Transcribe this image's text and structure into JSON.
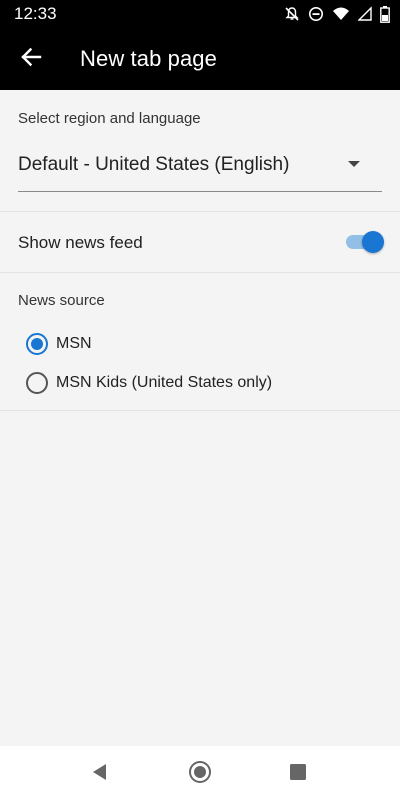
{
  "statusbar": {
    "time": "12:33",
    "icons": [
      "notifications-off-icon",
      "do-not-disturb-icon",
      "wifi-icon",
      "signal-icon",
      "battery-icon"
    ]
  },
  "appbar": {
    "title": "New tab page",
    "back_icon": "arrow-back-icon"
  },
  "region": {
    "label": "Select region and language",
    "selected_value": "Default - United States (English)"
  },
  "news_feed": {
    "label": "Show news feed",
    "enabled": true
  },
  "news_source": {
    "label": "News source",
    "options": [
      {
        "label": "MSN",
        "selected": true
      },
      {
        "label": "MSN Kids (United States only)",
        "selected": false
      }
    ]
  },
  "navbar": {
    "icons": [
      "nav-back-icon",
      "nav-home-icon",
      "nav-recents-icon"
    ]
  },
  "colors": {
    "accent": "#1976d2",
    "toggle_track": "#91bfe6",
    "appbar_bg": "#000000",
    "content_bg": "#f4f4f4"
  }
}
